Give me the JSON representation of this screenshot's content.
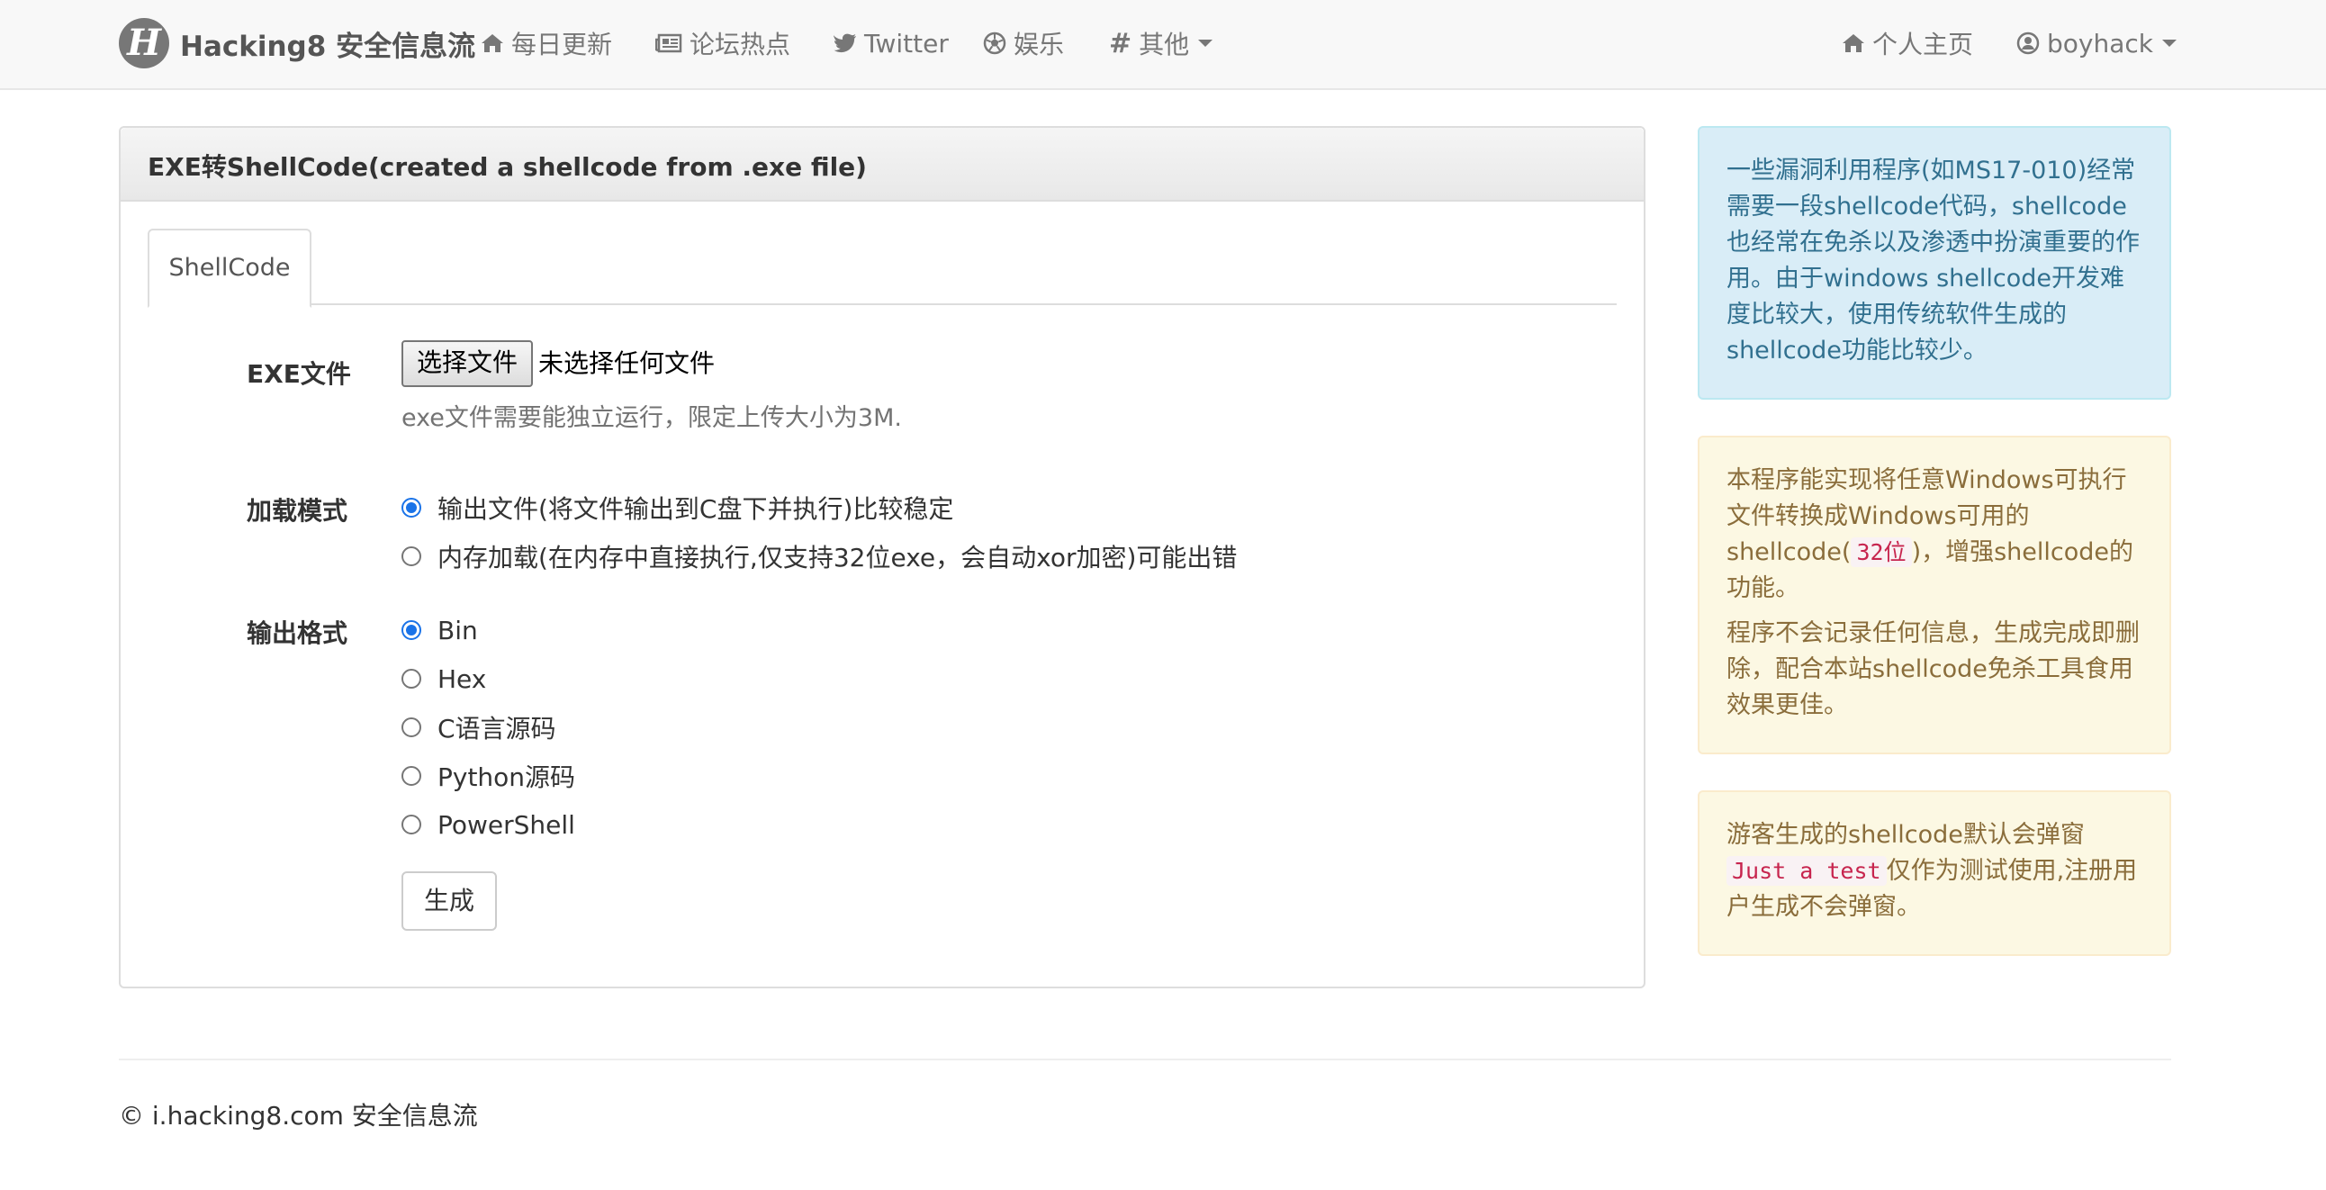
{
  "navbar": {
    "brand_logo_letter": "H",
    "brand_title": "Hacking8 安全信息流",
    "items": [
      {
        "icon": "home-icon",
        "label": "每日更新"
      },
      {
        "icon": "newspaper-icon",
        "label": "论坛热点"
      },
      {
        "icon": "twitter-icon",
        "label": "Twitter"
      },
      {
        "icon": "soccer-ball-icon",
        "label": "娱乐"
      },
      {
        "icon": "hashtag-icon",
        "label": "其他"
      }
    ],
    "right": {
      "home": {
        "icon": "home-icon",
        "label": "个人主页"
      },
      "user": {
        "icon": "user-circle-icon",
        "label": "boyhack"
      }
    }
  },
  "panel": {
    "title": "EXE转ShellCode(created a shellcode from .exe file)",
    "tab": "ShellCode",
    "file_label": "EXE文件",
    "file_button": "选择文件",
    "file_status": "未选择任何文件",
    "file_help": "exe文件需要能独立运行，限定上传大小为3M.",
    "load_mode_label": "加载模式",
    "load_modes": [
      {
        "label": "输出文件(将文件输出到C盘下并执行)比较稳定",
        "checked": true
      },
      {
        "label": "内存加载(在内存中直接执行,仅支持32位exe，会自动xor加密)可能出错",
        "checked": false
      }
    ],
    "output_format_label": "输出格式",
    "output_formats": [
      {
        "label": "Bin",
        "checked": true
      },
      {
        "label": "Hex",
        "checked": false
      },
      {
        "label": "C语言源码",
        "checked": false
      },
      {
        "label": "Python源码",
        "checked": false
      },
      {
        "label": "PowerShell",
        "checked": false
      }
    ],
    "submit_label": "生成"
  },
  "sidebar": {
    "info": "一些漏洞利用程序(如MS17-010)经常需要一段shellcode代码，shellcode也经常在免杀以及渗透中扮演重要的作用。由于windows shellcode开发难度比较大，使用传统软件生成的shellcode功能比较少。",
    "warn1": {
      "p1_before": "本程序能实现将任意Windows可执行文件转换成Windows可用的shellcode(",
      "p1_code": "32位",
      "p1_after": ")，增强shellcode的功能。",
      "p2": "程序不会记录任何信息，生成完成即删除，配合本站shellcode免杀工具食用效果更佳。"
    },
    "warn2": {
      "before": "游客生成的shellcode默认会弹窗",
      "code": "Just a test",
      "after": "仅作为测试使用,注册用户生成不会弹窗。"
    }
  },
  "footer": {
    "text": "© i.hacking8.com 安全信息流"
  },
  "colors": {
    "navbar_bg": "#f8f8f8",
    "info_bg": "#d9edf7",
    "info_text": "#31708f",
    "warn_bg": "#fcf8e3",
    "warn_text": "#8a6d3b",
    "radio_checked": "#1a73e8"
  }
}
